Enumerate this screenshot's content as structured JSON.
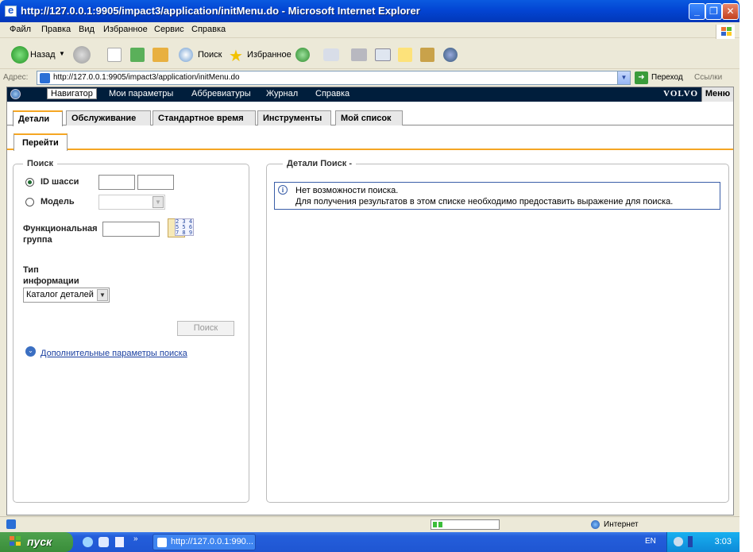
{
  "window": {
    "title": "http://127.0.0.1:9905/impact3/application/initMenu.do - Microsoft Internet Explorer"
  },
  "menubar": [
    "Файл",
    "Правка",
    "Вид",
    "Избранное",
    "Сервис",
    "Справка"
  ],
  "toolbar": {
    "back": "Назад",
    "search": "Поиск",
    "favorites": "Избранное"
  },
  "address": {
    "label": "Адрес:",
    "url": "http://127.0.0.1:9905/impact3/application/initMenu.do",
    "go": "Переход",
    "links": "Ссылки"
  },
  "app": {
    "nav": [
      "Навигатор",
      "Мои параметры",
      "Аббревиатуры",
      "Журнал",
      "Справка"
    ],
    "brand": "VOLVO",
    "menu": "Меню",
    "tabs": [
      "Детали",
      "Обслуживание",
      "Стандартное время",
      "Инструменты",
      "Мой список"
    ],
    "subtab": "Перейти",
    "search": {
      "legend": "Поиск",
      "chassis_label": "ID шасси",
      "model_label": "Модель",
      "func_group_label1": "Функциональная",
      "func_group_label2": "группа",
      "info_type_label1": "Тип",
      "info_type_label2": "информации",
      "info_type_value": "Каталог деталей",
      "search_button": "Поиск",
      "advanced_link": "Дополнительные параметры поиска"
    },
    "details": {
      "legend": "Детали Поиск -",
      "message_line1": "Нет возможности поиска.",
      "message_line2": "Для получения результатов в этом списке необходимо предоставить выражение для поиска."
    }
  },
  "status": {
    "zone": "Интернет"
  },
  "taskbar": {
    "start": "пуск",
    "task": "http://127.0.0.1:990...",
    "lang": "EN",
    "clock": "3:03"
  }
}
